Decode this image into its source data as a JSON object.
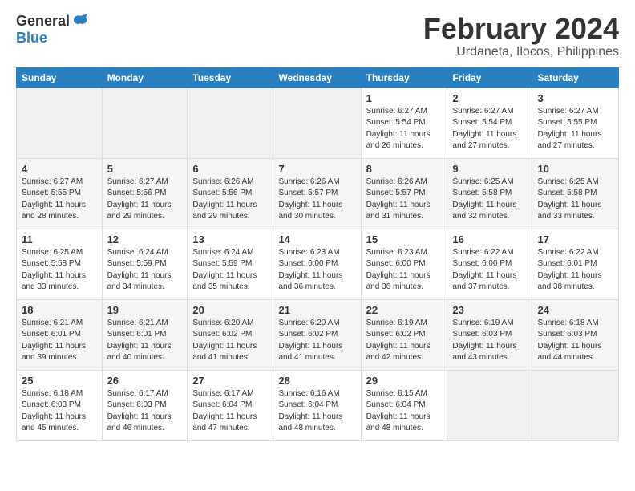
{
  "header": {
    "logo_general": "General",
    "logo_blue": "Blue",
    "month_year": "February 2024",
    "location": "Urdaneta, Ilocos, Philippines"
  },
  "days_of_week": [
    "Sunday",
    "Monday",
    "Tuesday",
    "Wednesday",
    "Thursday",
    "Friday",
    "Saturday"
  ],
  "weeks": [
    [
      {
        "day": "",
        "sunrise": "",
        "sunset": "",
        "daylight": "",
        "empty": true
      },
      {
        "day": "",
        "sunrise": "",
        "sunset": "",
        "daylight": "",
        "empty": true
      },
      {
        "day": "",
        "sunrise": "",
        "sunset": "",
        "daylight": "",
        "empty": true
      },
      {
        "day": "",
        "sunrise": "",
        "sunset": "",
        "daylight": "",
        "empty": true
      },
      {
        "day": "1",
        "sunrise": "6:27 AM",
        "sunset": "5:54 PM",
        "daylight": "11 hours and 26 minutes."
      },
      {
        "day": "2",
        "sunrise": "6:27 AM",
        "sunset": "5:54 PM",
        "daylight": "11 hours and 27 minutes."
      },
      {
        "day": "3",
        "sunrise": "6:27 AM",
        "sunset": "5:55 PM",
        "daylight": "11 hours and 27 minutes."
      }
    ],
    [
      {
        "day": "4",
        "sunrise": "6:27 AM",
        "sunset": "5:55 PM",
        "daylight": "11 hours and 28 minutes."
      },
      {
        "day": "5",
        "sunrise": "6:27 AM",
        "sunset": "5:56 PM",
        "daylight": "11 hours and 29 minutes."
      },
      {
        "day": "6",
        "sunrise": "6:26 AM",
        "sunset": "5:56 PM",
        "daylight": "11 hours and 29 minutes."
      },
      {
        "day": "7",
        "sunrise": "6:26 AM",
        "sunset": "5:57 PM",
        "daylight": "11 hours and 30 minutes."
      },
      {
        "day": "8",
        "sunrise": "6:26 AM",
        "sunset": "5:57 PM",
        "daylight": "11 hours and 31 minutes."
      },
      {
        "day": "9",
        "sunrise": "6:25 AM",
        "sunset": "5:58 PM",
        "daylight": "11 hours and 32 minutes."
      },
      {
        "day": "10",
        "sunrise": "6:25 AM",
        "sunset": "5:58 PM",
        "daylight": "11 hours and 33 minutes."
      }
    ],
    [
      {
        "day": "11",
        "sunrise": "6:25 AM",
        "sunset": "5:58 PM",
        "daylight": "11 hours and 33 minutes."
      },
      {
        "day": "12",
        "sunrise": "6:24 AM",
        "sunset": "5:59 PM",
        "daylight": "11 hours and 34 minutes."
      },
      {
        "day": "13",
        "sunrise": "6:24 AM",
        "sunset": "5:59 PM",
        "daylight": "11 hours and 35 minutes."
      },
      {
        "day": "14",
        "sunrise": "6:23 AM",
        "sunset": "6:00 PM",
        "daylight": "11 hours and 36 minutes."
      },
      {
        "day": "15",
        "sunrise": "6:23 AM",
        "sunset": "6:00 PM",
        "daylight": "11 hours and 36 minutes."
      },
      {
        "day": "16",
        "sunrise": "6:22 AM",
        "sunset": "6:00 PM",
        "daylight": "11 hours and 37 minutes."
      },
      {
        "day": "17",
        "sunrise": "6:22 AM",
        "sunset": "6:01 PM",
        "daylight": "11 hours and 38 minutes."
      }
    ],
    [
      {
        "day": "18",
        "sunrise": "6:21 AM",
        "sunset": "6:01 PM",
        "daylight": "11 hours and 39 minutes."
      },
      {
        "day": "19",
        "sunrise": "6:21 AM",
        "sunset": "6:01 PM",
        "daylight": "11 hours and 40 minutes."
      },
      {
        "day": "20",
        "sunrise": "6:20 AM",
        "sunset": "6:02 PM",
        "daylight": "11 hours and 41 minutes."
      },
      {
        "day": "21",
        "sunrise": "6:20 AM",
        "sunset": "6:02 PM",
        "daylight": "11 hours and 41 minutes."
      },
      {
        "day": "22",
        "sunrise": "6:19 AM",
        "sunset": "6:02 PM",
        "daylight": "11 hours and 42 minutes."
      },
      {
        "day": "23",
        "sunrise": "6:19 AM",
        "sunset": "6:03 PM",
        "daylight": "11 hours and 43 minutes."
      },
      {
        "day": "24",
        "sunrise": "6:18 AM",
        "sunset": "6:03 PM",
        "daylight": "11 hours and 44 minutes."
      }
    ],
    [
      {
        "day": "25",
        "sunrise": "6:18 AM",
        "sunset": "6:03 PM",
        "daylight": "11 hours and 45 minutes."
      },
      {
        "day": "26",
        "sunrise": "6:17 AM",
        "sunset": "6:03 PM",
        "daylight": "11 hours and 46 minutes."
      },
      {
        "day": "27",
        "sunrise": "6:17 AM",
        "sunset": "6:04 PM",
        "daylight": "11 hours and 47 minutes."
      },
      {
        "day": "28",
        "sunrise": "6:16 AM",
        "sunset": "6:04 PM",
        "daylight": "11 hours and 48 minutes."
      },
      {
        "day": "29",
        "sunrise": "6:15 AM",
        "sunset": "6:04 PM",
        "daylight": "11 hours and 48 minutes."
      },
      {
        "day": "",
        "sunrise": "",
        "sunset": "",
        "daylight": "",
        "empty": true
      },
      {
        "day": "",
        "sunrise": "",
        "sunset": "",
        "daylight": "",
        "empty": true
      }
    ]
  ]
}
